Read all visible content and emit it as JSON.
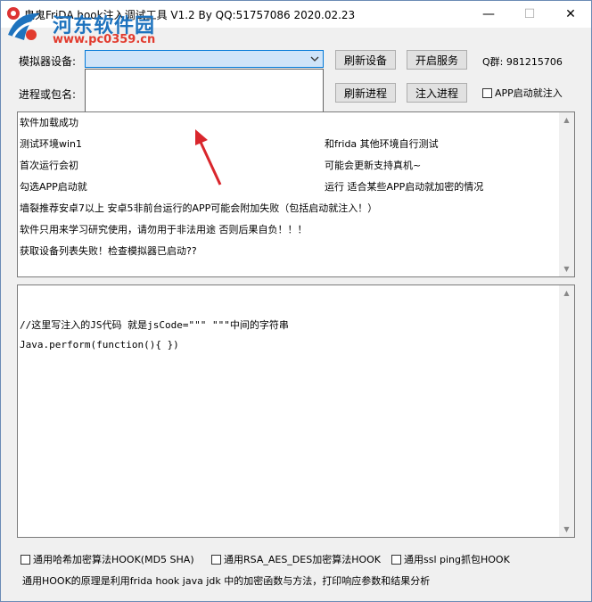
{
  "window": {
    "title": "鬼鬼FriDA hook注入调试工具 V1.2 By QQ:51757086 2020.02.23",
    "controls": {
      "minimize": "—",
      "maximize": "☐",
      "close": "✕"
    }
  },
  "watermark": {
    "title": "河东软件园",
    "url": "www.pc0359.cn"
  },
  "row1": {
    "label": "模拟器设备:",
    "combo_value": "",
    "refresh_devices": "刷新设备",
    "start_service": "开启服务",
    "qq_group": "Q群: 981215706"
  },
  "row2": {
    "label": "进程或包名:",
    "refresh_process": "刷新进程",
    "inject_process": "注入进程",
    "app_start_inject": "APP启动就注入"
  },
  "log": {
    "lines": [
      "软件加载成功",
      "测试环境win1",
      "首次运行会初",
      "勾选APP启动就",
      "墙裂推荐安卓7以上 安卓5非前台运行的APP可能会附加失败（包括启动就注入！）",
      "软件只用来学习研究使用，请勿用于非法用途 否则后果自负！！！",
      "获取设备列表失败！检查模拟器已启动??"
    ],
    "partial": {
      "line2_tail": "和frida 其他环境自行测试",
      "line3_tail": "可能会更新支持真机~",
      "line4_tail": "运行 适合某些APP启动就加密的情况"
    }
  },
  "code": {
    "lines": [
      "//这里写注入的JS代码  就是jsCode=\"\"\"       \"\"\"中间的字符串",
      "Java.perform(function(){ })"
    ]
  },
  "options": {
    "hash_hook": "通用哈希加密算法HOOK(MD5 SHA)",
    "rsa_hook": "通用RSA_AES_DES加密算法HOOK",
    "ssl_hook": "通用ssl ping抓包HOOK"
  },
  "footer": "通用HOOK的原理是利用frida hook java jdk 中的加密函数与方法，打印响应参数和结果分析",
  "colors": {
    "accent": "#0078d7",
    "combo_bg": "#cfe4f9",
    "arrow": "#d9262c",
    "watermark_blue": "#1e73be",
    "watermark_red": "#e23b2e"
  }
}
